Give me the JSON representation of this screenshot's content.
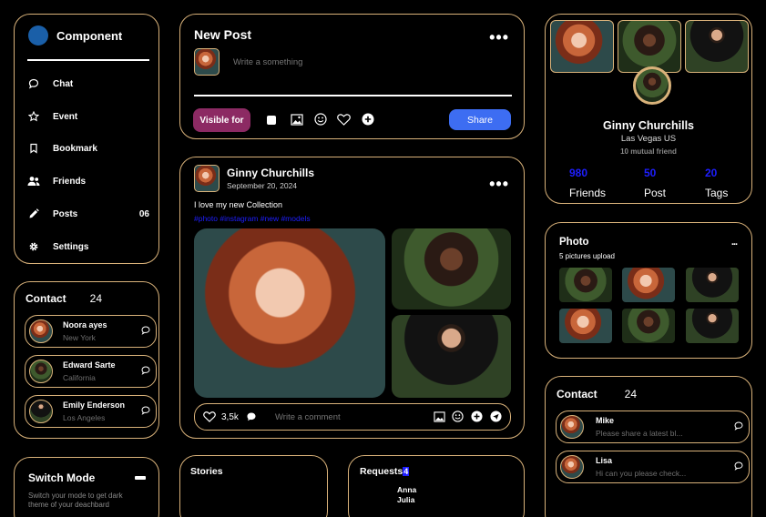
{
  "sidebar": {
    "title": "Component",
    "items": [
      {
        "label": "Chat",
        "icon": "chat-icon"
      },
      {
        "label": "Event",
        "icon": "star-icon"
      },
      {
        "label": "Bookmark",
        "icon": "bookmark-icon"
      },
      {
        "label": "Friends",
        "icon": "friends-icon"
      },
      {
        "label": "Posts",
        "icon": "pencil-icon",
        "badge": "06"
      },
      {
        "label": "Settings",
        "icon": "gear-icon"
      }
    ]
  },
  "contact_left": {
    "title": "Contact",
    "count": "24",
    "items": [
      {
        "name": "Noora ayes",
        "sub": "New York"
      },
      {
        "name": "Edward Sarte",
        "sub": "California"
      },
      {
        "name": "Emily Enderson",
        "sub": "Los Angeles"
      }
    ]
  },
  "switch_mode": {
    "title": "Switch Mode",
    "desc_line1": "Switch your mode to get dark",
    "desc_line2": "theme of your deachbard"
  },
  "new_post": {
    "title": "New Post",
    "placeholder": "Write a something",
    "visible_label": "Visible for",
    "share_label": "Share"
  },
  "post": {
    "author": "Ginny Churchills",
    "date": "September 20, 2024",
    "text": "I love my new Collection",
    "hashtags": "#photo #instagram #new #models",
    "likes": "3,5k",
    "comment_placeholder": "Write a comment"
  },
  "stories": {
    "title": "Stories"
  },
  "requests": {
    "title": "Requests",
    "count": "4",
    "names": [
      "Anna",
      "Julia"
    ]
  },
  "profile": {
    "name": "Ginny Churchills",
    "location": "Las Vegas US",
    "mutual": "10 mutual friend",
    "stats": [
      {
        "value": "980",
        "label": "Friends"
      },
      {
        "value": "50",
        "label": "Post"
      },
      {
        "value": "20",
        "label": "Tags"
      }
    ]
  },
  "photo": {
    "title": "Photo",
    "sub": "5 pictures upload"
  },
  "contact_right": {
    "title": "Contact",
    "count": "24",
    "items": [
      {
        "name": "Mike",
        "sub": "Please share a latest bl..."
      },
      {
        "name": "Lisa",
        "sub": "Hi can you please check..."
      }
    ]
  },
  "colors": {
    "accent": "#d9b27a",
    "share": "#3d6df2",
    "visible": "#8c2a63",
    "stat": "#1e1eff",
    "logo": "#1a5fa8"
  }
}
